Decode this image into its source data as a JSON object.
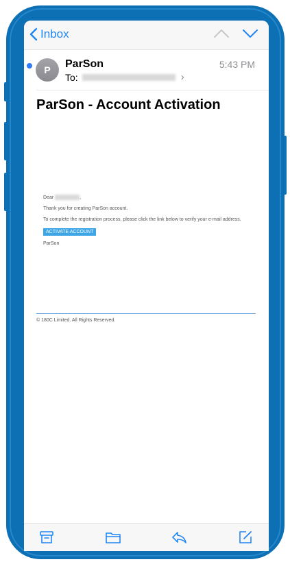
{
  "nav": {
    "back_label": "Inbox",
    "back_icon": "chevron-left-icon",
    "prev_icon": "chevron-up-icon",
    "next_icon": "chevron-down-icon"
  },
  "message": {
    "avatar_initial": "P",
    "sender": "ParSon",
    "to_label": "To:",
    "time": "5:43 PM",
    "subject": "ParSon - Account Activation"
  },
  "email": {
    "greeting": "Dear",
    "greeting_end": ",",
    "line1": "Thank you for creating ParSon account.",
    "line2": "To complete the registration process, please click the link below to verify your e-mail address.",
    "button_label": "ACTIVATE ACCOUNT",
    "signature": "ParSon",
    "footer": "© 180C Limited. All Rights Reserved."
  },
  "toolbar": {
    "icons": [
      "archive-icon",
      "folder-icon",
      "reply-icon",
      "compose-icon"
    ]
  },
  "colors": {
    "frame": "#0d6fb4",
    "accent": "#1f86f5",
    "button": "#3ea6e6",
    "unread": "#2f7bf6"
  }
}
